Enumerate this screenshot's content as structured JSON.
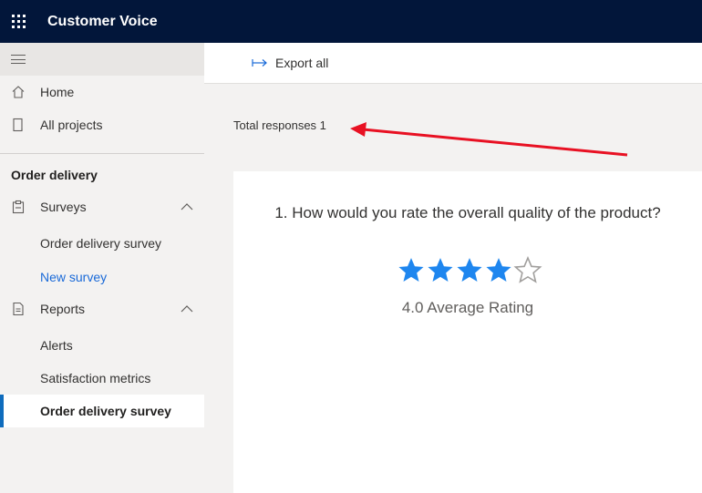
{
  "app": {
    "title": "Customer Voice"
  },
  "sidebar": {
    "home": "Home",
    "all_projects": "All projects",
    "section_title": "Order delivery",
    "surveys": "Surveys",
    "survey_items": [
      "Order delivery survey",
      "New survey"
    ],
    "reports": "Reports",
    "report_items": [
      "Alerts",
      "Satisfaction metrics",
      "Order delivery survey"
    ]
  },
  "toolbar": {
    "export_label": "Export all"
  },
  "summary": {
    "total_responses": "Total responses 1"
  },
  "question": {
    "text": "1. How would you rate the overall quality of the product?",
    "rating": 4,
    "max_rating": 5,
    "average_label": "4.0 Average Rating"
  },
  "colors": {
    "star_filled": "#1e86ef",
    "star_empty": "#a19f9d",
    "arrow": "#e81123",
    "accent": "#0f6cbd"
  }
}
